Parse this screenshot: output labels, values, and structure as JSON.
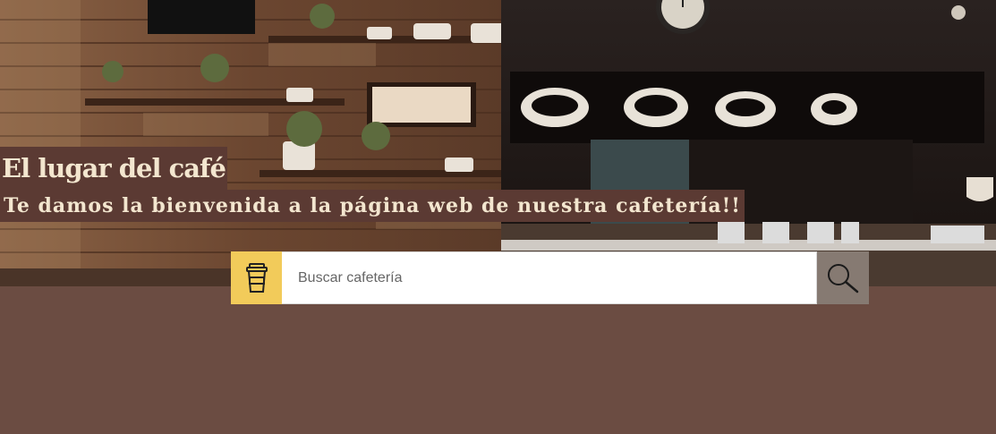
{
  "hero": {
    "title": "El lugar del café",
    "subtitle": "Te damos la bienvenida a la página web de nuestra cafetería!!",
    "background_description_colors": {
      "wood": "#6e4a32",
      "dark": "#1f1715",
      "page": "#6b4c42"
    }
  },
  "search": {
    "placeholder": "Buscar cafetería",
    "value": "",
    "leading_icon": "coffee-cup-icon",
    "button_icon": "magnifier-icon",
    "accent_color": "#f2cb5a",
    "button_color": "#867a72"
  }
}
